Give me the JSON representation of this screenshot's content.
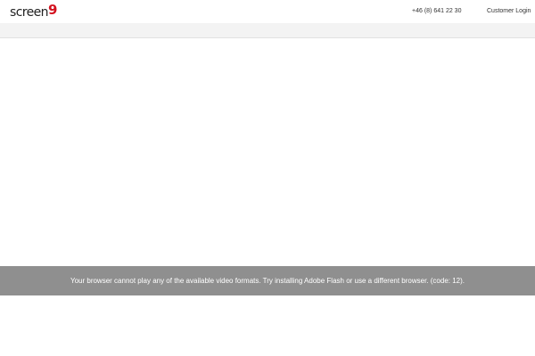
{
  "header": {
    "logo": {
      "text": "screen",
      "mark": "9",
      "mark_color": "#d3121f"
    },
    "phone": "+46 (8) 641 22 30",
    "login_label": "Customer Login"
  },
  "player": {
    "error_message": "Your browser cannot play any of the available video formats. Try installing Adobe Flash or use a different browser. (code: 12)."
  },
  "colors": {
    "error_bar_bg": "#8f8f8f",
    "subbar_bg": "#f3f3f3"
  }
}
